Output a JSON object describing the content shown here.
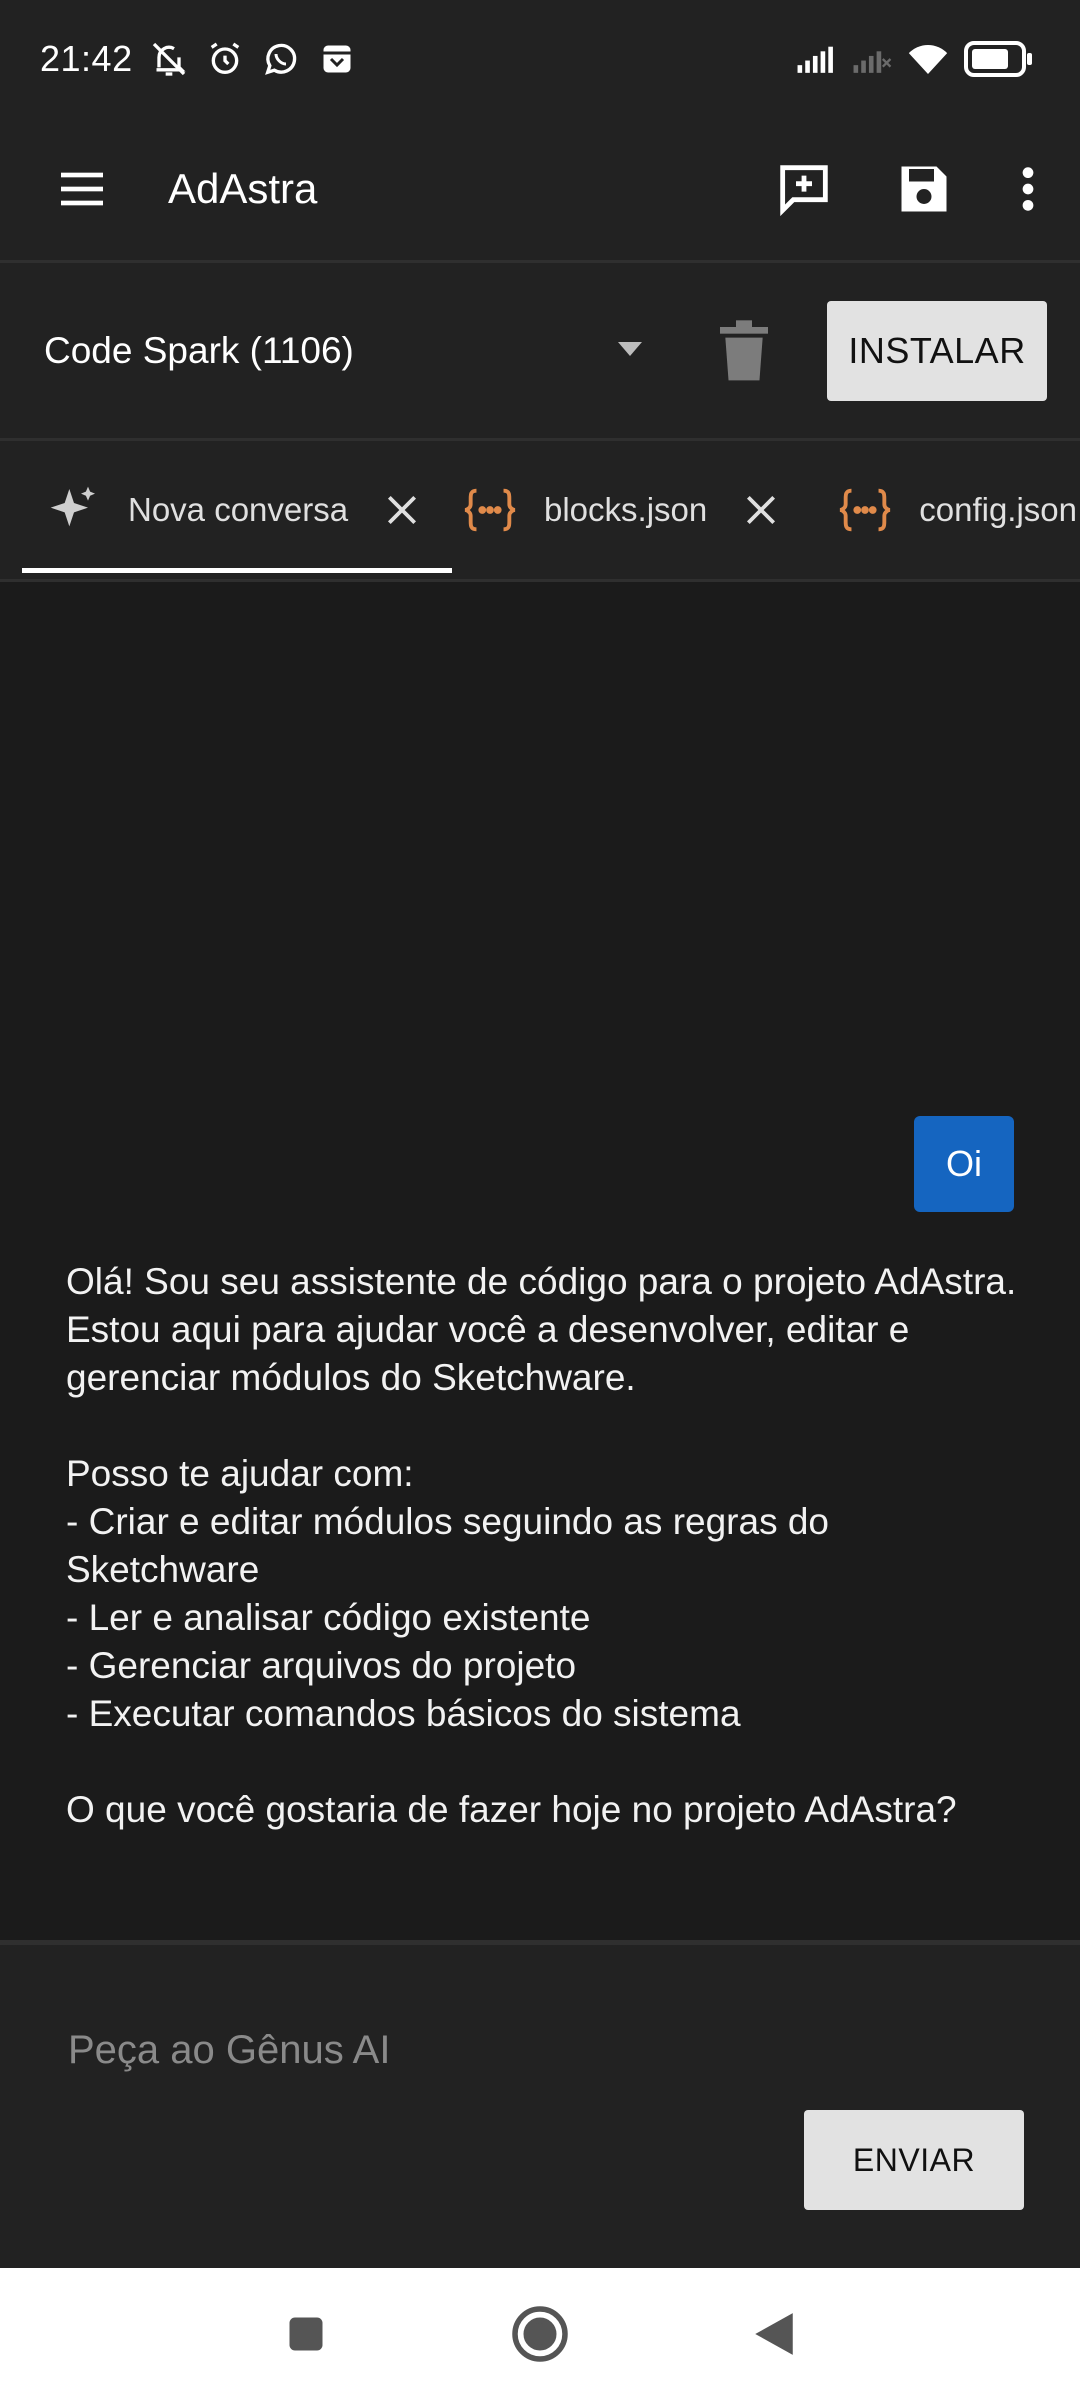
{
  "status_bar": {
    "time": "21:42"
  },
  "app_bar": {
    "title": "AdAstra"
  },
  "project": {
    "selected": "Code Spark (1106)",
    "install_label": "INSTALAR"
  },
  "tabs": [
    {
      "label": "Nova conversa",
      "icon": "sparkle-icon",
      "active": true
    },
    {
      "label": "blocks.json",
      "icon": "json-braces-icon",
      "active": false
    },
    {
      "label": "config.json",
      "icon": "json-braces-icon",
      "active": false
    }
  ],
  "chat": {
    "user_message": "Oi",
    "assistant_message": "Olá! Sou seu assistente de código para o projeto AdAstra. Estou aqui para ajudar você a desenvolver, editar e gerenciar módulos do Sketchware.\n\nPosso te ajudar com:\n- Criar e editar módulos seguindo as regras do Sketchware\n- Ler e analisar código existente\n- Gerenciar arquivos do projeto\n- Executar comandos básicos do sistema\n\nO que você gostaria de fazer hoje no projeto AdAstra?"
  },
  "composer": {
    "placeholder": "Peça ao Gênus AI",
    "value": "",
    "send_label": "ENVIAR"
  },
  "colors": {
    "accent_blue": "#1565c0",
    "json_icon_orange": "#e08a4a",
    "button_bg": "#e2e2e2"
  }
}
